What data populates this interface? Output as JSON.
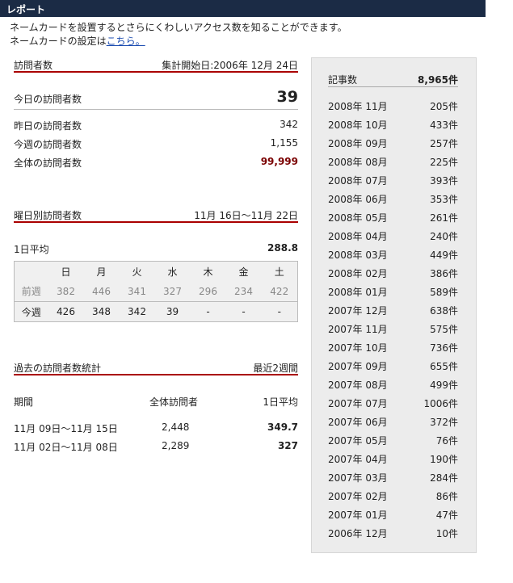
{
  "header": {
    "title": "レポート"
  },
  "intro": {
    "line1": "ネームカードを設置するとさらにくわしいアクセス数を知ることができます。",
    "line2_prefix": "ネームカードの設定は",
    "line2_link": "こちら。"
  },
  "visitors": {
    "title": "訪問者数",
    "start_label": "集計開始日:2006年 12月 24日",
    "today_label": "今日の訪問者数",
    "today_value": "39",
    "yesterday_label": "昨日の訪問者数",
    "yesterday_value": "342",
    "week_label": "今週の訪問者数",
    "week_value": "1,155",
    "total_label": "全体の訪問者数",
    "total_value": "99,999"
  },
  "weekday": {
    "title": "曜日別訪問者数",
    "range": "11月 16日～11月 22日",
    "avg_label": "1日平均",
    "avg_value": "288.8",
    "days": [
      "日",
      "月",
      "火",
      "水",
      "木",
      "金",
      "土"
    ],
    "prev_label": "前週",
    "prev": [
      "382",
      "446",
      "341",
      "327",
      "296",
      "234",
      "422"
    ],
    "cur_label": "今週",
    "cur": [
      "426",
      "348",
      "342",
      "39",
      "-",
      "-",
      "-"
    ]
  },
  "past": {
    "title": "過去の訪問者数統計",
    "range": "最近2週間",
    "col_period": "期間",
    "col_total": "全体訪問者",
    "col_avg": "1日平均",
    "rows": [
      {
        "period": "11月 09日～11月 15日",
        "total": "2,448",
        "avg": "349.7"
      },
      {
        "period": "11月 02日～11月 08日",
        "total": "2,289",
        "avg": "327"
      }
    ]
  },
  "articles": {
    "label": "記事数",
    "total": "8,965件",
    "months": [
      {
        "month": "2008年 11月",
        "count": "205件"
      },
      {
        "month": "2008年 10月",
        "count": "433件"
      },
      {
        "month": "2008年 09月",
        "count": "257件"
      },
      {
        "month": "2008年 08月",
        "count": "225件"
      },
      {
        "month": "2008年 07月",
        "count": "393件"
      },
      {
        "month": "2008年 06月",
        "count": "353件"
      },
      {
        "month": "2008年 05月",
        "count": "261件"
      },
      {
        "month": "2008年 04月",
        "count": "240件"
      },
      {
        "month": "2008年 03月",
        "count": "449件"
      },
      {
        "month": "2008年 02月",
        "count": "386件"
      },
      {
        "month": "2008年 01月",
        "count": "589件"
      },
      {
        "month": "2007年 12月",
        "count": "638件"
      },
      {
        "month": "2007年 11月",
        "count": "575件"
      },
      {
        "month": "2007年 10月",
        "count": "736件"
      },
      {
        "month": "2007年 09月",
        "count": "655件"
      },
      {
        "month": "2007年 08月",
        "count": "499件"
      },
      {
        "month": "2007年 07月",
        "count": "1006件"
      },
      {
        "month": "2007年 06月",
        "count": "372件"
      },
      {
        "month": "2007年 05月",
        "count": "76件"
      },
      {
        "month": "2007年 04月",
        "count": "190件"
      },
      {
        "month": "2007年 03月",
        "count": "284件"
      },
      {
        "month": "2007年 02月",
        "count": "86件"
      },
      {
        "month": "2007年 01月",
        "count": "47件"
      },
      {
        "month": "2006年 12月",
        "count": "10件"
      }
    ]
  },
  "colors": {
    "header_bg": "#1b2b45",
    "accent_red": "#aa0000",
    "total_red": "#7a0000",
    "link": "#1a4bb0"
  }
}
